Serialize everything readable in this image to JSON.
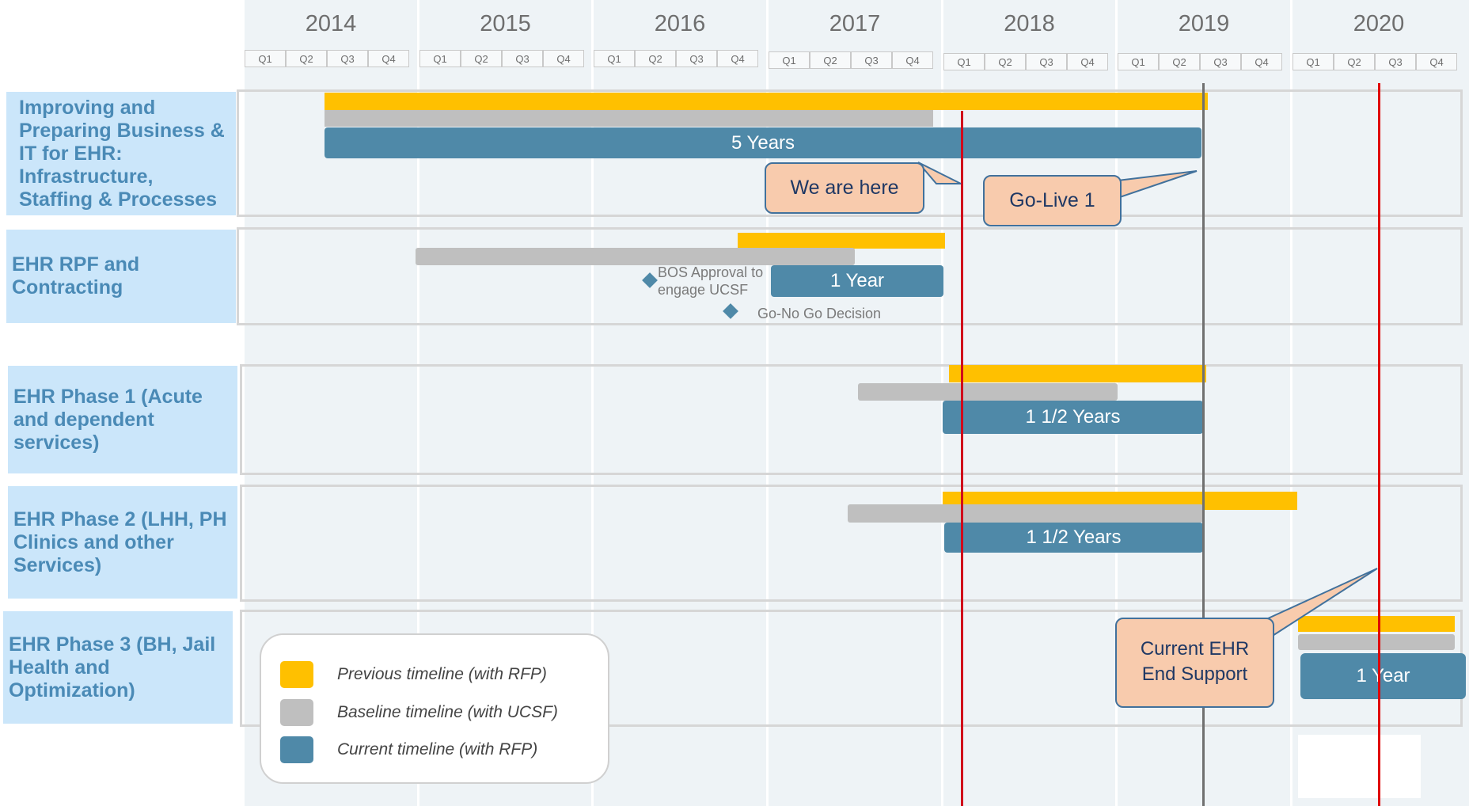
{
  "years": [
    "2014",
    "2015",
    "2016",
    "2017",
    "2018",
    "2019",
    "2020"
  ],
  "quarters": [
    "Q1",
    "Q2",
    "Q3",
    "Q4"
  ],
  "rows": [
    {
      "label": [
        "Improving and",
        "Preparing Business &",
        "IT for EHR:",
        "Infrastructure,",
        "Staffing & Processes"
      ]
    },
    {
      "label": [
        "EHR RPF and",
        "Contracting"
      ]
    },
    {
      "label": [
        "EHR Phase 1 (Acute",
        "and dependent",
        "services)"
      ]
    },
    {
      "label": [
        "EHR Phase 2 (LHH, PH",
        "Clinics and other",
        "Services)"
      ]
    },
    {
      "label": [
        "EHR Phase 3 (BH, Jail",
        "Health and",
        "Optimization)"
      ]
    }
  ],
  "bars": {
    "row1_current": "5 Years",
    "row2_current": "1  Year",
    "row3_current": "1 1/2 Years",
    "row4_current": "1 1/2 Years",
    "row5_current": "1 Year"
  },
  "milestones": {
    "bos_approval": [
      "BOS Approval to",
      "engage UCSF"
    ],
    "go_no_go": "Go-No Go Decision"
  },
  "callouts": {
    "we_are_here": "We are here",
    "go_live": "Go-Live 1",
    "end_support": [
      "Current EHR",
      "End Support"
    ]
  },
  "legend": {
    "previous": "Previous timeline (with RFP)",
    "baseline": "Baseline timeline (with UCSF)",
    "current": "Current timeline (with RFP)"
  },
  "colors": {
    "previous": "#ffc000",
    "baseline": "#bfbfbf",
    "current": "#4f89a8",
    "today_line": "#d0021b",
    "golive_line": "#707070",
    "row_label_bg": "#cbe6fa",
    "callout_bg": "#f8cbad"
  }
}
